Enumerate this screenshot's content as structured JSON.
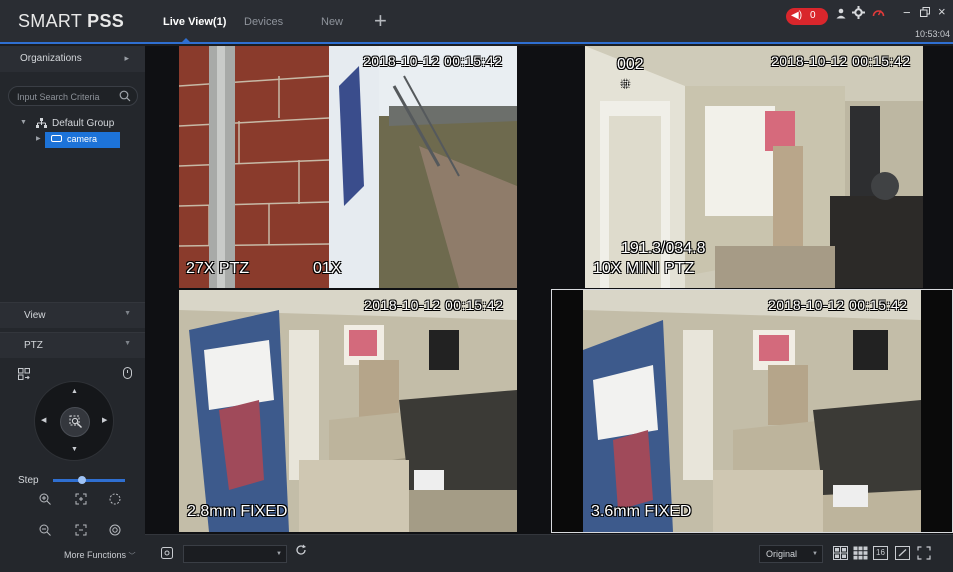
{
  "app": {
    "logo_light": "SMART",
    "logo_bold": "PSS",
    "tabs": [
      {
        "label": "Live View(1)",
        "active": true
      },
      {
        "label": "Devices",
        "active": false
      },
      {
        "label": "New",
        "active": false
      }
    ],
    "add_tab_label": "+",
    "alarm_count": "0",
    "clock": "10:53:04",
    "accent_color": "#2f6fd1",
    "alarm_color": "#d9262c"
  },
  "sidebar": {
    "organizations_label": "Organizations",
    "search_placeholder": "Input Search Criteria",
    "tree": {
      "group_label": "Default Group",
      "device_label": "camera"
    },
    "view_label": "View",
    "ptz_label": "PTZ",
    "step_label": "Step",
    "step_value": 0.4,
    "more_functions_label": "More Functions"
  },
  "video": {
    "cells": [
      {
        "timestamp": "2018-10-12 00:15:42",
        "label": "27X PTZ",
        "label2": "01X",
        "channel": "",
        "coords": ""
      },
      {
        "timestamp": "2018-10-12 00:15:42",
        "label": "10X MINI PTZ",
        "label2": "",
        "channel": "002",
        "coords": "191.3/034.8"
      },
      {
        "timestamp": "2018-10-12 00:15:42",
        "label": "2.8mm FIXED",
        "label2": "",
        "channel": "",
        "coords": ""
      },
      {
        "timestamp": "2018-10-12 00:15:42",
        "label": "3.6mm FIXED",
        "label2": "",
        "channel": "",
        "coords": ""
      }
    ],
    "selected_cell": 3
  },
  "toolbar": {
    "stream_select_value": "",
    "ratio_value": "Original",
    "layout_16_label": "16"
  }
}
